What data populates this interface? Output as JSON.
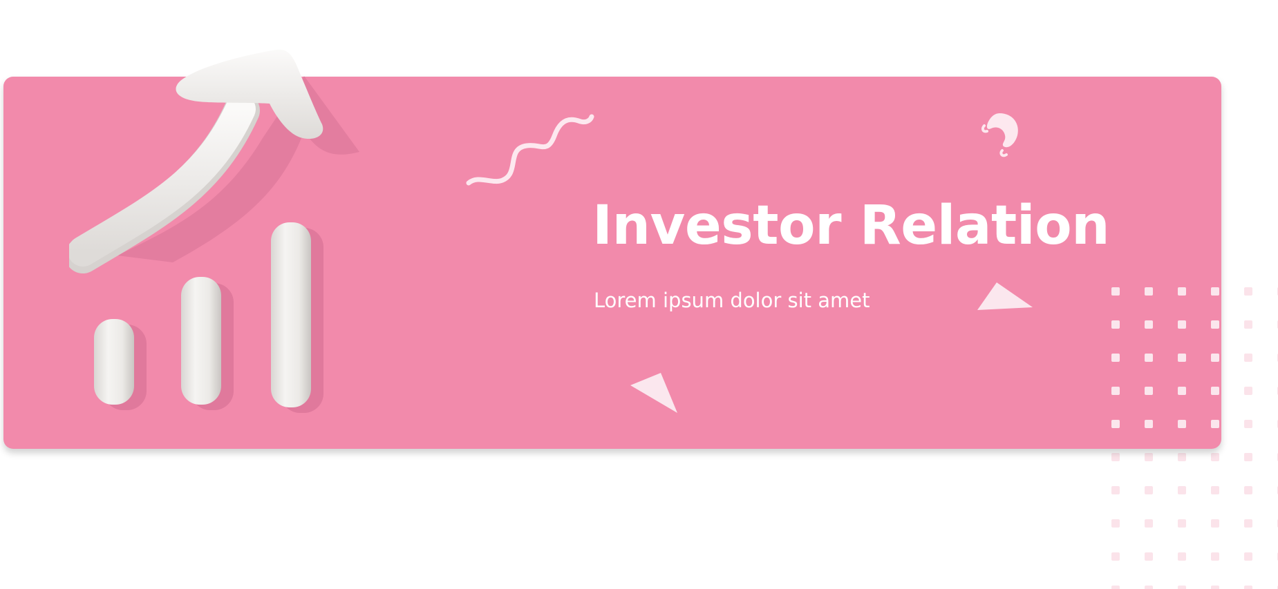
{
  "banner": {
    "title": "Investor Relation",
    "subtitle": "Lorem ipsum dolor sit amet",
    "background_color": "#f28aab",
    "text_color": "#ffffff"
  },
  "illustration": {
    "icon": "growth-chart-arrow-icon",
    "color": "#efedeb"
  },
  "decorations": [
    "squiggle-icon",
    "swirl-icon",
    "triangle-icon",
    "dot-grid-pattern"
  ]
}
